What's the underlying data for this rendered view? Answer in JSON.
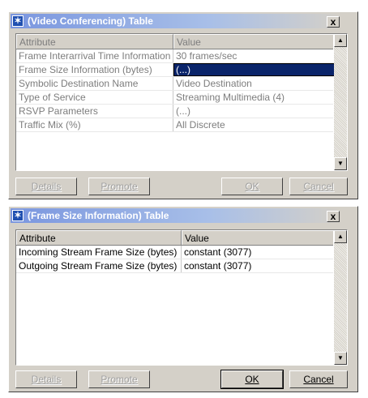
{
  "dialog1": {
    "title": "(Video Conferencing) Table",
    "close_label": "x",
    "columns": [
      "Attribute",
      "Value"
    ],
    "rows": [
      {
        "attribute": "Frame Interarrival Time Information",
        "value": "30 frames/sec"
      },
      {
        "attribute": "Frame Size Information (bytes)",
        "value": "(...)"
      },
      {
        "attribute": "Symbolic Destination Name",
        "value": "Video Destination"
      },
      {
        "attribute": "Type of Service",
        "value": "Streaming Multimedia (4)"
      },
      {
        "attribute": "RSVP Parameters",
        "value": "(...)"
      },
      {
        "attribute": "Traffic Mix (%)",
        "value": "All Discrete"
      }
    ],
    "buttons": {
      "details": "Details",
      "promote": "Promote",
      "ok": "OK",
      "cancel": "Cancel"
    }
  },
  "dialog2": {
    "title": "(Frame Size Information) Table",
    "close_label": "x",
    "columns": [
      "Attribute",
      "Value"
    ],
    "rows": [
      {
        "attribute": "Incoming Stream Frame Size (bytes)",
        "value": "constant (3077)"
      },
      {
        "attribute": "Outgoing Stream Frame Size (bytes)",
        "value": "constant (3077)"
      }
    ],
    "buttons": {
      "details": "Details",
      "promote": "Promote",
      "ok": "OK",
      "cancel": "Cancel"
    }
  },
  "icons": {
    "title_icon": "asterisk-star-icon",
    "close": "close-icon",
    "scroll_up": "arrow-up-icon",
    "scroll_down": "arrow-down-icon"
  },
  "colors": {
    "active_title": "#0a246a",
    "inactive_title": "#7a96df",
    "selection": "#0a246a",
    "dialog_bg": "#d4d0c8"
  }
}
